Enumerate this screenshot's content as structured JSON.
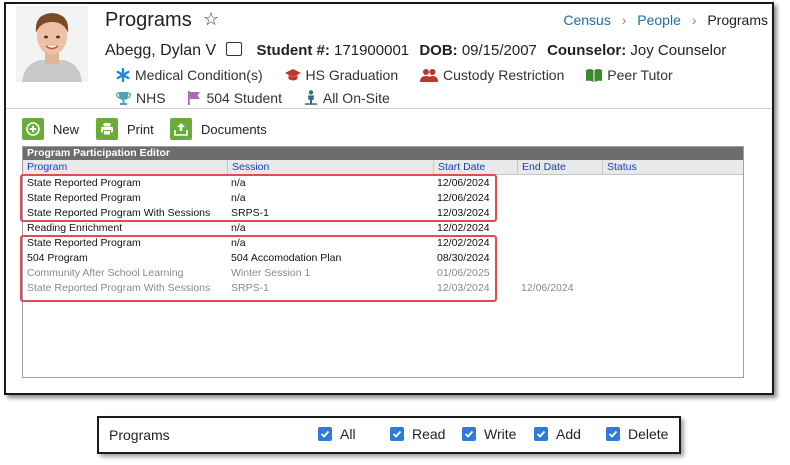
{
  "header": {
    "title": "Programs",
    "breadcrumbs": [
      "Census",
      "People",
      "Programs"
    ]
  },
  "student": {
    "name": "Abegg, Dylan V",
    "student_num_label": "Student #:",
    "student_num": "171900001",
    "dob_label": "DOB:",
    "dob": "09/15/2007",
    "counselor_label": "Counselor:",
    "counselor": "Joy Counselor"
  },
  "flags": [
    {
      "label": "Medical Condition(s)",
      "icon": "asterisk-icon",
      "color": "#1e88d8"
    },
    {
      "label": "HS Graduation",
      "icon": "graduation-cap-icon",
      "color": "#c0342c"
    },
    {
      "label": "Custody Restriction",
      "icon": "people-icon",
      "color": "#c0342c"
    },
    {
      "label": "Peer Tutor",
      "icon": "book-icon",
      "color": "#3c8a2e"
    },
    {
      "label": "NHS",
      "icon": "trophy-icon",
      "color": "#4aa3b8"
    },
    {
      "label": "504 Student",
      "icon": "flag-icon",
      "color": "#a36db0"
    },
    {
      "label": "All On-Site",
      "icon": "person-icon",
      "color": "#2f6f7f"
    }
  ],
  "toolbar": {
    "new_label": "New",
    "print_label": "Print",
    "documents_label": "Documents"
  },
  "editor": {
    "title": "Program Participation Editor",
    "columns": [
      "Program",
      "Session",
      "Start Date",
      "End Date",
      "Status"
    ],
    "rows": [
      {
        "program": "State Reported Program",
        "session": "n/a",
        "start": "12/06/2024",
        "end": "",
        "status": "",
        "dim": false
      },
      {
        "program": "State Reported Program",
        "session": "n/a",
        "start": "12/06/2024",
        "end": "",
        "status": "",
        "dim": false
      },
      {
        "program": "State Reported Program With Sessions",
        "session": "SRPS-1",
        "start": "12/03/2024",
        "end": "",
        "status": "",
        "dim": false
      },
      {
        "program": "Reading Enrichment",
        "session": "n/a",
        "start": "12/02/2024",
        "end": "",
        "status": "",
        "dim": false
      },
      {
        "program": "State Reported Program",
        "session": "n/a",
        "start": "12/02/2024",
        "end": "",
        "status": "",
        "dim": false
      },
      {
        "program": "504 Program",
        "session": "504 Accomodation Plan",
        "start": "08/30/2024",
        "end": "",
        "status": "",
        "dim": false
      },
      {
        "program": "Community After School Learning",
        "session": "Winter Session 1",
        "start": "01/06/2025",
        "end": "",
        "status": "",
        "dim": true
      },
      {
        "program": "State Reported Program With Sessions",
        "session": "SRPS-1",
        "start": "12/03/2024",
        "end": "12/06/2024",
        "status": "",
        "dim": true
      }
    ]
  },
  "permissions": {
    "title": "Programs",
    "options": [
      {
        "label": "All",
        "checked": true
      },
      {
        "label": "Read",
        "checked": true
      },
      {
        "label": "Write",
        "checked": true
      },
      {
        "label": "Add",
        "checked": true
      },
      {
        "label": "Delete",
        "checked": true
      }
    ]
  },
  "colors": {
    "link": "#1e6fa8",
    "toolbar_icon": "#6aab3b",
    "highlight": "#e34a54",
    "checkbox": "#2d7bd6",
    "editor_title_bg": "#6d6d6d",
    "column_header_text": "#1a3cc8"
  }
}
